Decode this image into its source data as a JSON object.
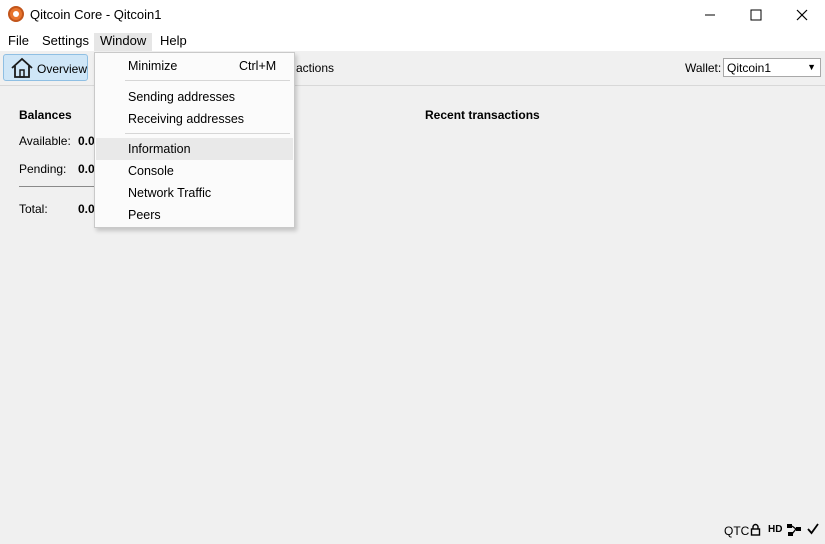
{
  "window": {
    "title": "Qitcoin Core - Qitcoin1"
  },
  "menubar": {
    "items": [
      "File",
      "Settings",
      "Window",
      "Help"
    ]
  },
  "toolbar": {
    "overview_label": "Overview",
    "transactions_partial": "actions",
    "wallet_label": "Wallet:",
    "wallet_value": "Qitcoin1"
  },
  "balances": {
    "heading": "Balances",
    "available_label": "Available:",
    "available_value": "0.0",
    "pending_label": "Pending:",
    "pending_value": "0.0",
    "total_label": "Total:",
    "total_value": "0.0"
  },
  "recent": {
    "heading": "Recent transactions"
  },
  "window_menu": {
    "minimize": "Minimize",
    "minimize_shortcut": "Ctrl+M",
    "sending_addresses": "Sending addresses",
    "receiving_addresses": "Receiving addresses",
    "information": "Information",
    "console": "Console",
    "network_traffic": "Network Traffic",
    "peers": "Peers"
  },
  "statusbar": {
    "unit": "QTC",
    "hd": "HD"
  },
  "icons": [
    "qitcoin-logo-icon",
    "minimize-icon",
    "maximize-icon",
    "close-icon",
    "home-icon",
    "chevron-down-icon",
    "lock-icon",
    "network-icon",
    "checkmark-icon"
  ]
}
